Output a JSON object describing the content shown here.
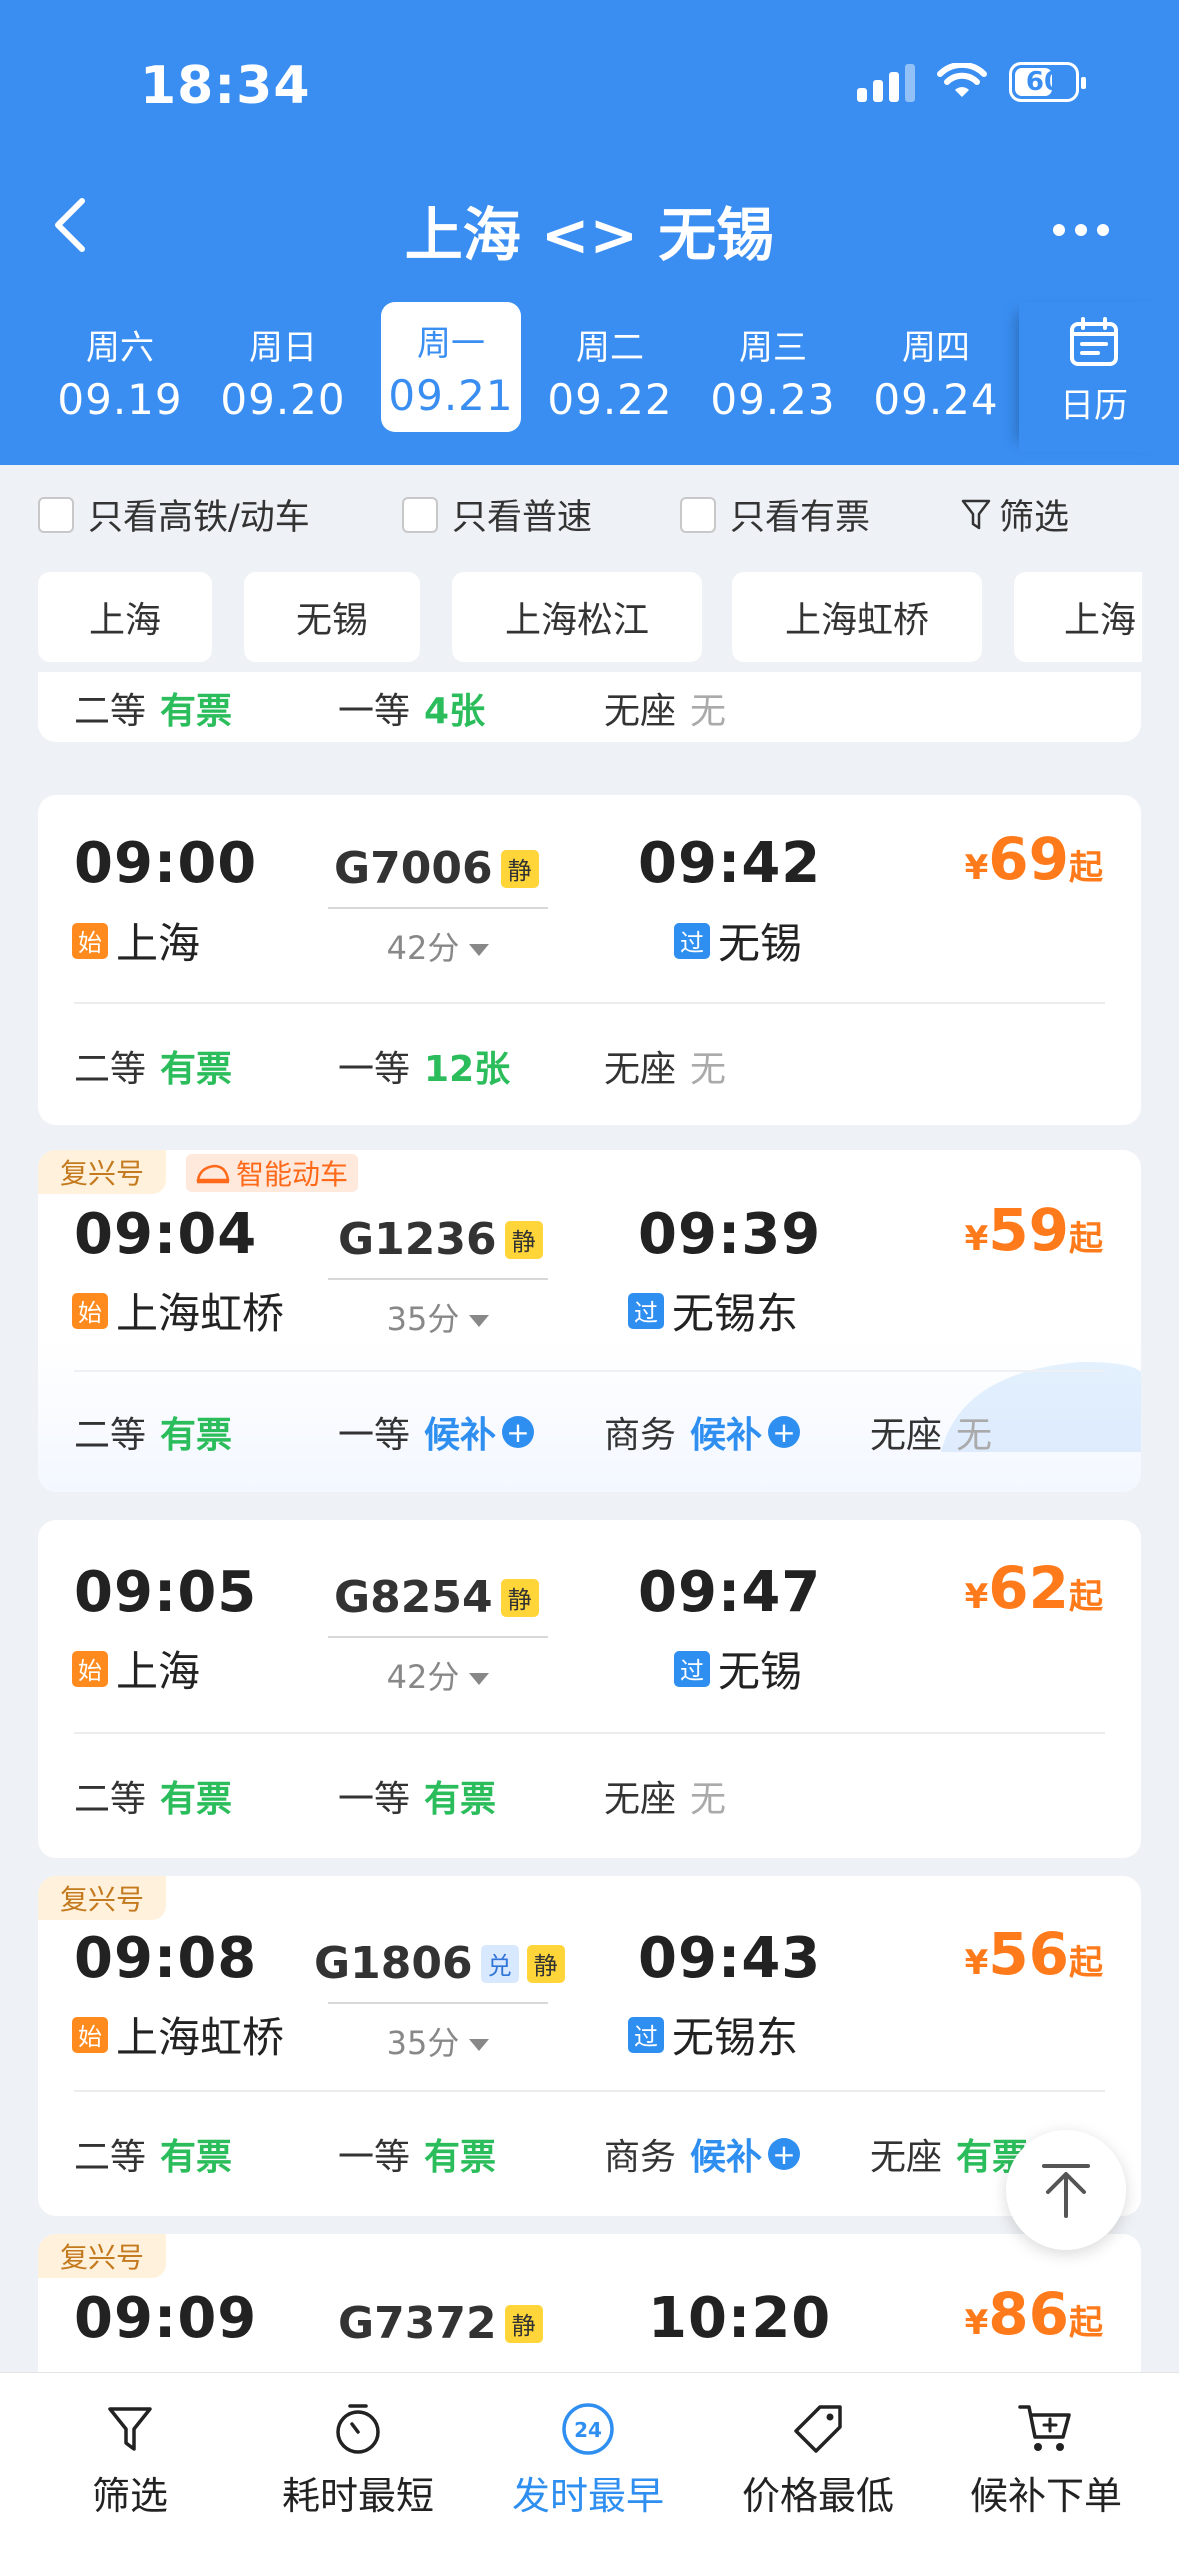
{
  "status": {
    "time": "18:34",
    "battery": "60"
  },
  "header": {
    "title": "上海 <> 无锡"
  },
  "dates": [
    {
      "weekday": "周六",
      "date": "09.19"
    },
    {
      "weekday": "周日",
      "date": "09.20"
    },
    {
      "weekday": "周一",
      "date": "09.21",
      "active": true
    },
    {
      "weekday": "周二",
      "date": "09.22"
    },
    {
      "weekday": "周三",
      "date": "09.23"
    },
    {
      "weekday": "周四",
      "date": "09.24"
    }
  ],
  "calendar_label": "日历",
  "filters": {
    "gaotie": "只看高铁/动车",
    "pusu": "只看普速",
    "youpiao": "只看有票",
    "filter": "筛选"
  },
  "stations": [
    "上海",
    "无锡",
    "上海松江",
    "上海虹桥",
    "上海"
  ],
  "partial_card": {
    "seats": [
      {
        "cls": "二等",
        "status": "有票"
      },
      {
        "cls": "一等",
        "status": "4张"
      },
      {
        "cls": "无座",
        "status": "无"
      }
    ]
  },
  "trains": [
    {
      "dep": "09:00",
      "arr": "09:42",
      "no": "G7006",
      "jing": "静",
      "dep_tag": "始",
      "dep_st": "上海",
      "arr_tag": "过",
      "arr_st": "无锡",
      "duration": "42分",
      "cur": "¥",
      "price": "69",
      "qi": "起",
      "seats": [
        {
          "cls": "二等",
          "status": "有票"
        },
        {
          "cls": "一等",
          "status": "12张"
        },
        {
          "cls": "无座",
          "status": "无"
        }
      ]
    },
    {
      "badge": "复兴号",
      "smart": "智能动车",
      "dep": "09:04",
      "arr": "09:39",
      "no": "G1236",
      "jing": "静",
      "dep_tag": "始",
      "dep_st": "上海虹桥",
      "arr_tag": "过",
      "arr_st": "无锡东",
      "duration": "35分",
      "cur": "¥",
      "price": "59",
      "qi": "起",
      "seats": [
        {
          "cls": "二等",
          "status": "有票"
        },
        {
          "cls": "一等",
          "status": "候补"
        },
        {
          "cls": "商务",
          "status": "候补"
        },
        {
          "cls": "无座",
          "status": "无"
        }
      ]
    },
    {
      "dep": "09:05",
      "arr": "09:47",
      "no": "G8254",
      "jing": "静",
      "dep_tag": "始",
      "dep_st": "上海",
      "arr_tag": "过",
      "arr_st": "无锡",
      "duration": "42分",
      "cur": "¥",
      "price": "62",
      "qi": "起",
      "seats": [
        {
          "cls": "二等",
          "status": "有票"
        },
        {
          "cls": "一等",
          "status": "有票"
        },
        {
          "cls": "无座",
          "status": "无"
        }
      ]
    },
    {
      "badge": "复兴号",
      "dep": "09:08",
      "arr": "09:43",
      "no": "G1806",
      "dui": "兑",
      "jing": "静",
      "dep_tag": "始",
      "dep_st": "上海虹桥",
      "arr_tag": "过",
      "arr_st": "无锡东",
      "duration": "35分",
      "cur": "¥",
      "price": "56",
      "qi": "起",
      "seats": [
        {
          "cls": "二等",
          "status": "有票"
        },
        {
          "cls": "一等",
          "status": "有票"
        },
        {
          "cls": "商务",
          "status": "候补"
        },
        {
          "cls": "无座",
          "status": "有票"
        }
      ]
    },
    {
      "badge": "复兴号",
      "dep": "09:09",
      "arr": "10:20",
      "no": "G7372",
      "jing": "静",
      "cur": "¥",
      "price": "86",
      "qi": "起"
    }
  ],
  "tabs": [
    {
      "label": "筛选",
      "icon": "filter-icon"
    },
    {
      "label": "耗时最短",
      "icon": "timer-icon"
    },
    {
      "label": "发时最早",
      "icon": "clock-24-icon",
      "badge": "24",
      "active": true
    },
    {
      "label": "价格最低",
      "icon": "price-tag-icon"
    },
    {
      "label": "候补下单",
      "icon": "cart-icon"
    }
  ],
  "colors": {
    "brand": "#3a8ef2",
    "price": "#ff7a1a",
    "available": "#2bbd5b",
    "waitlist": "#2f8ff0"
  }
}
